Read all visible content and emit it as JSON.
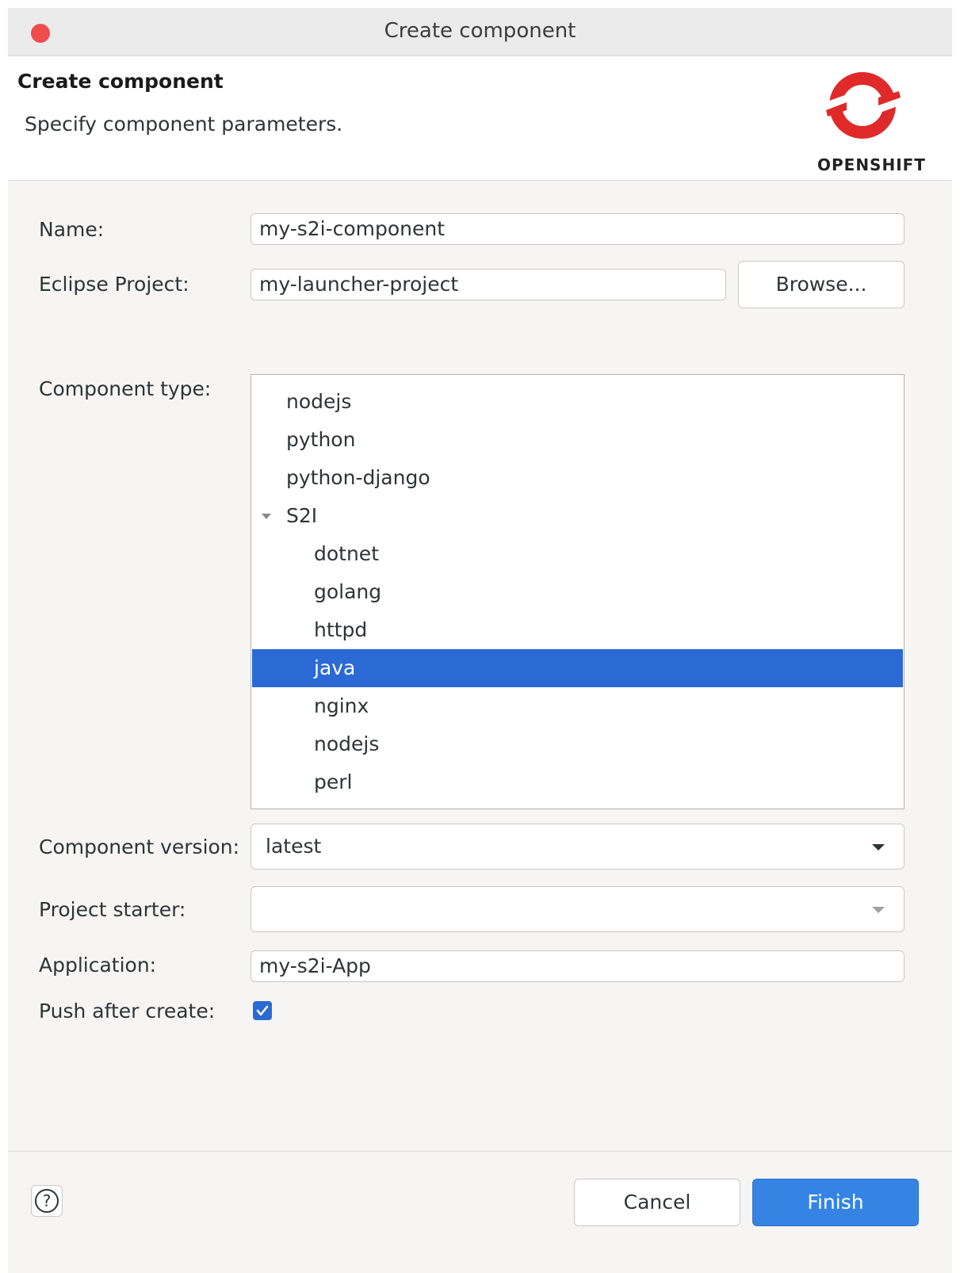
{
  "window": {
    "title": "Create component"
  },
  "header": {
    "title": "Create component",
    "subtitle": "Specify component parameters.",
    "logo_text": "OPENSHIFT"
  },
  "form": {
    "name": {
      "label": "Name:",
      "value": "my-s2i-component"
    },
    "eclipse_project": {
      "label": "Eclipse Project:",
      "value": "my-launcher-project",
      "browse_label": "Browse..."
    },
    "component_type": {
      "label": "Component type:",
      "items": [
        {
          "label": "nodejs",
          "level": 1,
          "selected": false
        },
        {
          "label": "python",
          "level": 1,
          "selected": false
        },
        {
          "label": "python-django",
          "level": 1,
          "selected": false
        },
        {
          "label": "S2I",
          "level": 0,
          "expanded": true,
          "selected": false
        },
        {
          "label": "dotnet",
          "level": 2,
          "selected": false
        },
        {
          "label": "golang",
          "level": 2,
          "selected": false
        },
        {
          "label": "httpd",
          "level": 2,
          "selected": false
        },
        {
          "label": "java",
          "level": 2,
          "selected": true
        },
        {
          "label": "nginx",
          "level": 2,
          "selected": false
        },
        {
          "label": "nodejs",
          "level": 2,
          "selected": false
        },
        {
          "label": "perl",
          "level": 2,
          "selected": false
        }
      ]
    },
    "component_version": {
      "label": "Component version:",
      "value": "latest"
    },
    "project_starter": {
      "label": "Project starter:",
      "value": ""
    },
    "application": {
      "label": "Application:",
      "value": "my-s2i-App"
    },
    "push_after_create": {
      "label": "Push after create:",
      "checked": true
    }
  },
  "footer": {
    "cancel_label": "Cancel",
    "finish_label": "Finish",
    "help_icon": "question-circle-icon"
  },
  "colors": {
    "selection": "#2b6ad4",
    "finish": "#3584e4",
    "close": "#ef4d4d",
    "logo": "#e02a2a"
  }
}
